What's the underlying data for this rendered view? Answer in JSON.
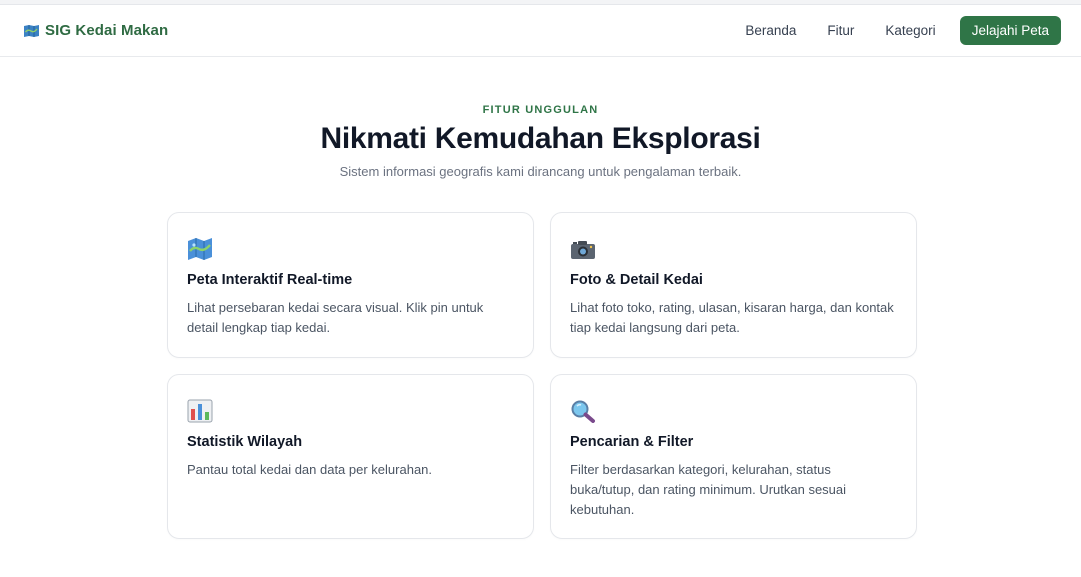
{
  "header": {
    "brand": "SIG Kedai Makan",
    "brand_icon": "map-icon",
    "nav": [
      "Beranda",
      "Fitur",
      "Kategori"
    ],
    "cta": "Jelajahi Peta"
  },
  "hero": {
    "eyebrow": "FITUR UNGGULAN",
    "title": "Nikmati Kemudahan Eksplorasi",
    "subtitle": "Sistem informasi geografis kami dirancang untuk pengalaman terbaik."
  },
  "features": [
    {
      "icon": "map-icon",
      "title": "Peta Interaktif Real-time",
      "desc": "Lihat persebaran kedai secara visual. Klik pin untuk detail lengkap tiap kedai."
    },
    {
      "icon": "camera-icon",
      "title": "Foto & Detail Kedai",
      "desc": "Lihat foto toko, rating, ulasan, kisaran harga, dan kontak tiap kedai langsung dari peta."
    },
    {
      "icon": "bar-chart-icon",
      "title": "Statistik Wilayah",
      "desc": "Pantau total kedai dan data per kelurahan."
    },
    {
      "icon": "magnifier-icon",
      "title": "Pencarian & Filter",
      "desc": "Filter berdasarkan kategori, kelurahan, status buka/tutup, dan rating minimum. Urutkan sesuai kebutuhan."
    }
  ],
  "colors": {
    "accent": "#2f7547",
    "brand_text": "#2f6b43",
    "title": "#111827",
    "muted": "#6b7280"
  }
}
